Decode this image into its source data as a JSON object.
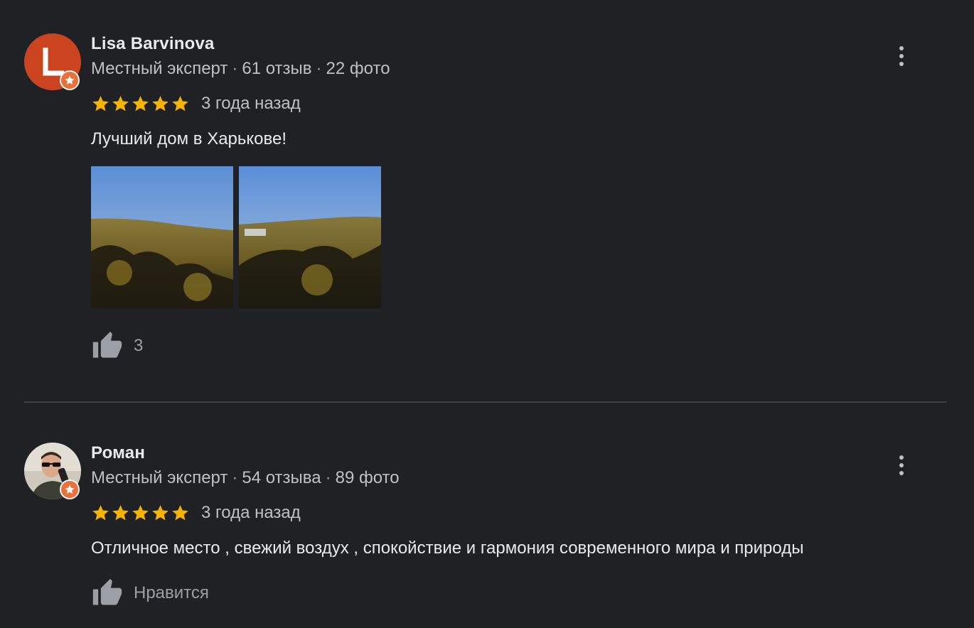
{
  "reviews": [
    {
      "author": "Lisa Barvinova",
      "avatar_letter": "L",
      "avatar_color": "#c9441f",
      "guide_label": "Местный эксперт",
      "review_count": "61 отзыв",
      "photo_count": "22 фото",
      "rating": 5,
      "time": "3 года назад",
      "text": "Лучший дом в Харькове!",
      "photos": [
        "autumn-forest-photo-1",
        "autumn-forest-photo-2"
      ],
      "likes": "3"
    },
    {
      "author": "Роман",
      "avatar_type": "photo",
      "guide_label": "Местный эксперт",
      "review_count": "54 отзыва",
      "photo_count": "89 фото",
      "rating": 5,
      "time": "3 года назад",
      "text": "Отличное место , свежий воздух , спокойствие и гармония современного мира и природы",
      "like_label": "Нравится"
    }
  ],
  "separator": "·",
  "colors": {
    "background": "#202124",
    "star": "#f4b400",
    "guide_badge": "#e8703a"
  },
  "icons": [
    "more-vert-icon",
    "thumb-up-icon",
    "star-icon",
    "local-guide-badge-icon"
  ]
}
